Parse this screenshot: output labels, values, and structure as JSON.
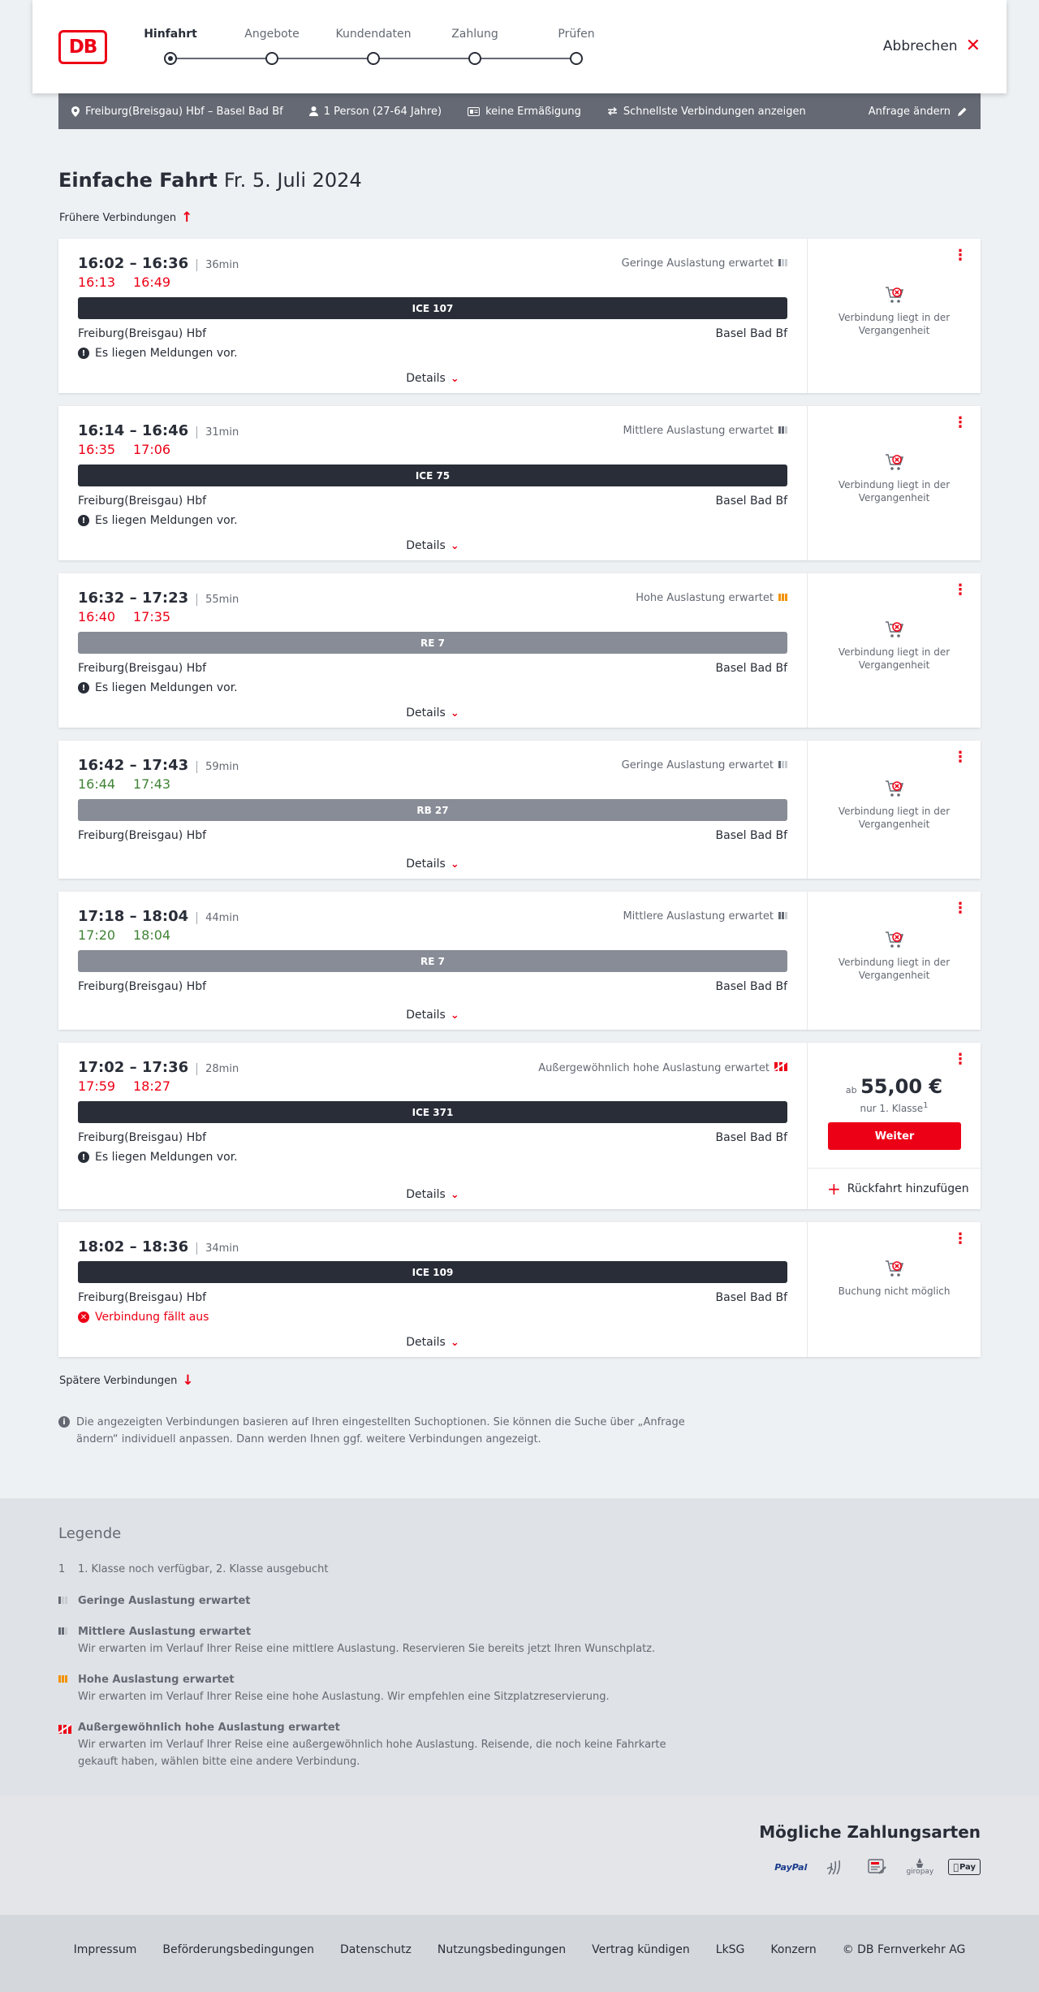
{
  "header": {
    "logo_text": "DB",
    "steps": [
      {
        "label": "Hinfahrt",
        "active": true
      },
      {
        "label": "Angebote",
        "active": false
      },
      {
        "label": "Kundendaten",
        "active": false
      },
      {
        "label": "Zahlung",
        "active": false
      },
      {
        "label": "Prüfen",
        "active": false
      }
    ],
    "cancel_label": "Abbrechen"
  },
  "summary": {
    "route": "Freiburg(Breisgau) Hbf – Basel Bad Bf",
    "passengers": "1 Person (27-64 Jahre)",
    "discount": "keine Ermäßigung",
    "option": "Schnellste Verbindungen anzeigen",
    "edit_label": "Anfrage ändern"
  },
  "page": {
    "title": "Einfache Fahrt",
    "date": "Fr. 5. Juli 2024",
    "earlier_label": "Frühere Verbindungen",
    "later_label": "Spätere Verbindungen",
    "info_text": "Die angezeigten Verbindungen basieren auf Ihren eingestellten Suchoptionen. Sie können die Suche über „Anfrage ändern“ individuell anpassen. Dann werden Ihnen ggf. weitere Verbindungen angezeigt."
  },
  "connections": [
    {
      "times": "16:02 – 16:36",
      "duration": "36min",
      "rt_dep": "16:13",
      "rt_arr": "16:49",
      "rt_color": "red",
      "occupancy": "Geringe Auslastung erwartet",
      "occ_level": 1,
      "train": "ICE 107",
      "train_style": "dark",
      "from": "Freiburg(Breisgau) Hbf",
      "to": "Basel Bad Bf",
      "message": "Es liegen Meldungen vor.",
      "details": "Details",
      "status": "Verbindung liegt in der Vergangenheit"
    },
    {
      "times": "16:14 – 16:46",
      "duration": "31min",
      "rt_dep": "16:35",
      "rt_arr": "17:06",
      "rt_color": "red",
      "occupancy": "Mittlere Auslastung erwartet",
      "occ_level": 2,
      "train": "ICE 75",
      "train_style": "dark",
      "from": "Freiburg(Breisgau) Hbf",
      "to": "Basel Bad Bf",
      "message": "Es liegen Meldungen vor.",
      "details": "Details",
      "status": "Verbindung liegt in der Vergangenheit"
    },
    {
      "times": "16:32 – 17:23",
      "duration": "55min",
      "rt_dep": "16:40",
      "rt_arr": "17:35",
      "rt_color": "red",
      "occupancy": "Hohe Auslastung erwartet",
      "occ_level": 3,
      "train": "RE 7",
      "train_style": "grey",
      "from": "Freiburg(Breisgau) Hbf",
      "to": "Basel Bad Bf",
      "message": "Es liegen Meldungen vor.",
      "details": "Details",
      "status": "Verbindung liegt in der Vergangenheit"
    },
    {
      "times": "16:42 – 17:43",
      "duration": "59min",
      "rt_dep": "16:44",
      "rt_arr": "17:43",
      "rt_color": "green",
      "occupancy": "Geringe Auslastung erwartet",
      "occ_level": 1,
      "train": "RB 27",
      "train_style": "grey",
      "from": "Freiburg(Breisgau) Hbf",
      "to": "Basel Bad Bf",
      "message": "",
      "details": "Details",
      "status": "Verbindung liegt in der Vergangenheit"
    },
    {
      "times": "17:18 – 18:04",
      "duration": "44min",
      "rt_dep": "17:20",
      "rt_arr": "18:04",
      "rt_color": "green",
      "occupancy": "Mittlere Auslastung erwartet",
      "occ_level": 2,
      "train": "RE 7",
      "train_style": "grey",
      "from": "Freiburg(Breisgau) Hbf",
      "to": "Basel Bad Bf",
      "message": "",
      "details": "Details",
      "status": "Verbindung liegt in der Vergangenheit"
    },
    {
      "times": "17:02 – 17:36",
      "duration": "28min",
      "rt_dep": "17:59",
      "rt_arr": "18:27",
      "rt_color": "red",
      "occupancy": "Außergewöhnlich hohe Auslastung erwartet",
      "occ_level": 4,
      "train": "ICE 371",
      "train_style": "dark",
      "from": "Freiburg(Breisgau) Hbf",
      "to": "Basel Bad Bf",
      "message": "Es liegen Meldungen vor.",
      "details": "Details",
      "price_prefix": "ab",
      "price": "55,00 €",
      "price_class": "nur 1. Klasse",
      "price_footnote": "1",
      "book_label": "Weiter",
      "return_label": "Rückfahrt hinzufügen"
    },
    {
      "times": "18:02 – 18:36",
      "duration": "34min",
      "rt_dep": "",
      "rt_arr": "",
      "rt_color": "",
      "occupancy": "",
      "occ_level": 0,
      "train": "ICE 109",
      "train_style": "dark",
      "from": "Freiburg(Breisgau) Hbf",
      "to": "Basel Bad Bf",
      "message": "Verbindung fällt aus",
      "message_type": "cancelled",
      "details": "Details",
      "status": "Buchung nicht möglich"
    }
  ],
  "legend": {
    "title": "Legende",
    "footnote_marker": "1",
    "footnote": "1. Klasse noch verfügbar, 2. Klasse ausgebucht",
    "items": [
      {
        "label": "Geringe Auslastung erwartet",
        "text": ""
      },
      {
        "label": "Mittlere Auslastung erwartet",
        "text": "Wir erwarten im Verlauf Ihrer Reise eine mittlere Auslastung. Reservieren Sie bereits jetzt Ihren Wunschplatz."
      },
      {
        "label": "Hohe Auslastung erwartet",
        "text": "Wir erwarten im Verlauf Ihrer Reise eine hohe Auslastung. Wir empfehlen eine Sitzplatzreservierung."
      },
      {
        "label": "Außergewöhnlich hohe Auslastung erwartet",
        "text": "Wir erwarten im Verlauf Ihrer Reise eine außergewöhnlich hohe Auslastung. Reisende, die noch keine Fahrkarte gekauft haben, wählen bitte eine andere Verbindung."
      }
    ]
  },
  "payment": {
    "title": "Mögliche Zahlungsarten",
    "methods": [
      "PayPal",
      "giropay",
      "Pay"
    ]
  },
  "footer": {
    "links": [
      "Impressum",
      "Beförderungsbedingungen",
      "Datenschutz",
      "Nutzungsbedingungen",
      "Vertrag kündigen",
      "LkSG",
      "Konzern",
      "© DB Fernverkehr AG"
    ]
  }
}
